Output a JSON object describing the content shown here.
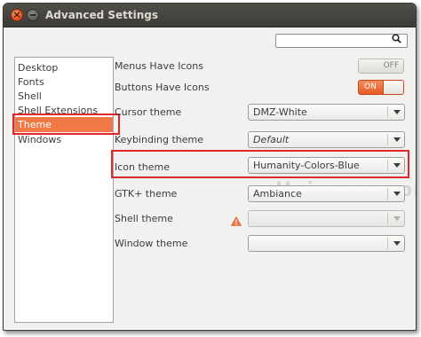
{
  "window": {
    "title": "Advanced Settings"
  },
  "search": {
    "placeholder": "",
    "icon": "search-icon"
  },
  "sidebar": {
    "items": [
      {
        "label": "Desktop",
        "selected": false
      },
      {
        "label": "Fonts",
        "selected": false
      },
      {
        "label": "Shell",
        "selected": false
      },
      {
        "label": "Shell Extensions",
        "selected": false
      },
      {
        "label": "Theme",
        "selected": true
      },
      {
        "label": "Windows",
        "selected": false
      }
    ]
  },
  "settings": {
    "menus_have_icons": {
      "label": "Menus Have Icons",
      "state": "OFF"
    },
    "buttons_have_icons": {
      "label": "Buttons Have Icons",
      "state": "ON"
    },
    "cursor_theme": {
      "label": "Cursor theme",
      "value": "DMZ-White"
    },
    "keybinding_theme": {
      "label": "Keybinding theme",
      "value": "Default"
    },
    "icon_theme": {
      "label": "Icon theme",
      "value": "Humanity-Colors-Blue"
    },
    "gtk_theme": {
      "label": "GTK+ theme",
      "value": "Ambiance"
    },
    "shell_theme": {
      "label": "Shell theme",
      "value": "",
      "warning_icon": "warning-icon"
    },
    "window_theme": {
      "label": "Window theme",
      "value": ""
    }
  },
  "watermark": {
    "text": "Unixmen.com"
  },
  "colors": {
    "accent": "#f07746",
    "highlight_box": "#e0282a",
    "titlebar": "#3c3b37"
  }
}
